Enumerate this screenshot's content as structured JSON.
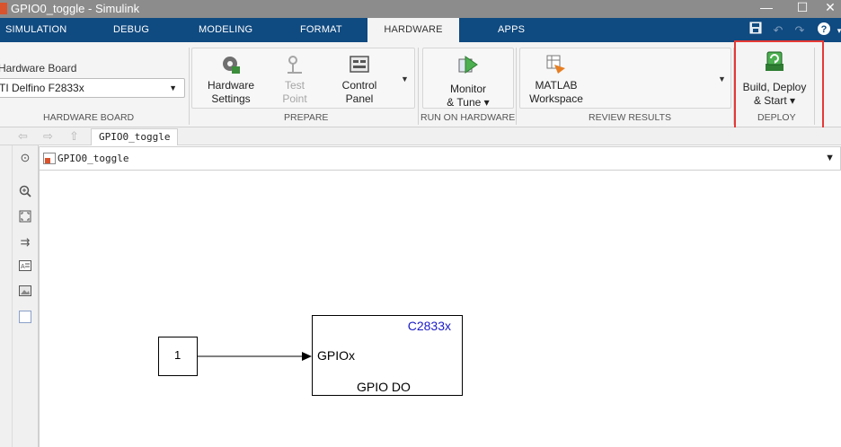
{
  "window": {
    "title": "GPIO0_toggle - Simulink",
    "minimize": "—",
    "maximize": "☐",
    "close": "✕"
  },
  "tabs": [
    {
      "label": "SIMULATION",
      "active": false
    },
    {
      "label": "DEBUG",
      "active": false
    },
    {
      "label": "MODELING",
      "active": false
    },
    {
      "label": "FORMAT",
      "active": false
    },
    {
      "label": "HARDWARE",
      "active": true
    },
    {
      "label": "APPS",
      "active": false
    }
  ],
  "ribbon": {
    "hardware_board": {
      "label": "Hardware Board",
      "value": "TI Delfino F2833x",
      "group": "HARDWARE BOARD"
    },
    "prepare": {
      "group": "PREPARE",
      "hardware_settings": {
        "line1": "Hardware",
        "line2": "Settings"
      },
      "test_point": {
        "line1": "Test",
        "line2": "Point"
      },
      "control_panel": {
        "line1": "Control",
        "line2": "Panel"
      }
    },
    "run_on_hardware": {
      "group": "RUN ON HARDWARE",
      "monitor_tune": {
        "line1": "Monitor",
        "line2": "& Tune ▾"
      }
    },
    "review_results": {
      "group": "REVIEW RESULTS",
      "matlab_workspace": {
        "line1": "MATLAB",
        "line2": "Workspace"
      }
    },
    "deploy": {
      "group": "DEPLOY",
      "build_deploy": {
        "line1": "Build, Deploy",
        "line2": "& Start ▾"
      }
    }
  },
  "nav": {
    "tab_label": "GPIO0_toggle"
  },
  "address": {
    "path": "GPIO0_toggle"
  },
  "model": {
    "constant_value": "1",
    "gpio_block": {
      "chip": "C2833x",
      "port": "GPIOx",
      "name": "GPIO DO"
    }
  },
  "colors": {
    "tab_strip": "#0f4a80",
    "highlight": "#e53935",
    "chip_label": "#1a1ac8"
  }
}
